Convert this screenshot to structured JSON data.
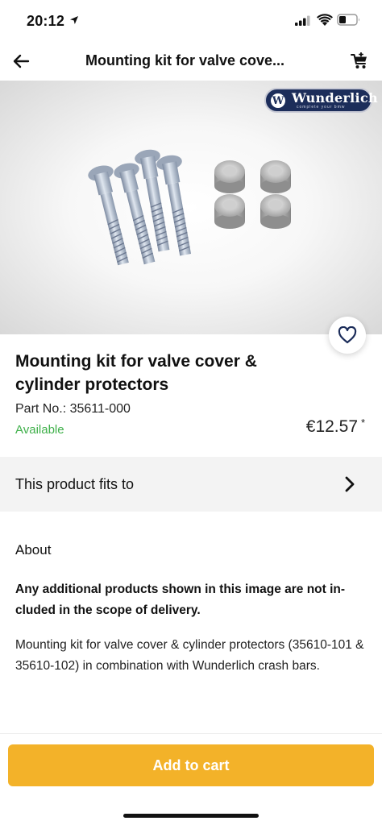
{
  "status_bar": {
    "time": "20:12",
    "icons": [
      "location-arrow-icon",
      "cellular-signal-icon",
      "wifi-icon",
      "battery-icon"
    ]
  },
  "nav": {
    "back_icon": "arrow-left-icon",
    "title": "Mounting kit for valve cove...",
    "cart_icon": "shopping-cart-icon"
  },
  "product_image": {
    "brand_name": "Wunderlich",
    "brand_tagline": "complete your BMW",
    "brand_emblem_letter": "W",
    "brand_color": "#1c2d5a"
  },
  "product": {
    "title": "Mounting kit for valve cover & cylinder protectors",
    "part_no": "Part No.: 35611-000",
    "availability": "Available",
    "availability_color": "#3fb04a",
    "price": "€12.57",
    "price_asterisk": "*",
    "favorite_icon": "heart-outline-icon"
  },
  "fits": {
    "label": "This product fits to",
    "chevron_icon": "chevron-right-icon"
  },
  "about": {
    "heading": "About",
    "note": "Any additional products shown in this image are not in-cluded in the scope of delivery.",
    "description": "Mounting kit for valve cover & cylinder protectors (35610-101 & 35610-102) in combination with Wunderlich crash bars."
  },
  "cart_button": {
    "label": "Add to cart",
    "color": "#f3b229"
  }
}
